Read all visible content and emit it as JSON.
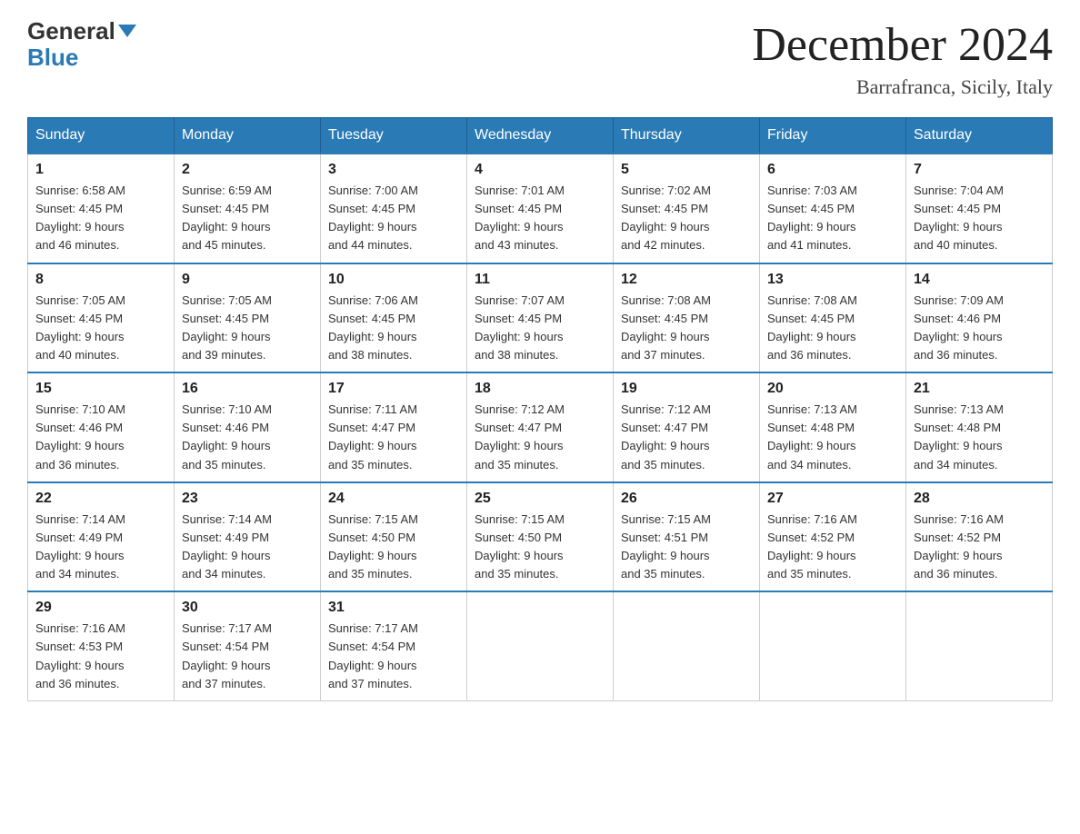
{
  "header": {
    "logo_line1": "General",
    "logo_line2": "Blue",
    "month_title": "December 2024",
    "location": "Barrafranca, Sicily, Italy"
  },
  "days_of_week": [
    "Sunday",
    "Monday",
    "Tuesday",
    "Wednesday",
    "Thursday",
    "Friday",
    "Saturday"
  ],
  "weeks": [
    [
      {
        "day": "1",
        "sunrise": "6:58 AM",
        "sunset": "4:45 PM",
        "daylight": "9 hours and 46 minutes."
      },
      {
        "day": "2",
        "sunrise": "6:59 AM",
        "sunset": "4:45 PM",
        "daylight": "9 hours and 45 minutes."
      },
      {
        "day": "3",
        "sunrise": "7:00 AM",
        "sunset": "4:45 PM",
        "daylight": "9 hours and 44 minutes."
      },
      {
        "day": "4",
        "sunrise": "7:01 AM",
        "sunset": "4:45 PM",
        "daylight": "9 hours and 43 minutes."
      },
      {
        "day": "5",
        "sunrise": "7:02 AM",
        "sunset": "4:45 PM",
        "daylight": "9 hours and 42 minutes."
      },
      {
        "day": "6",
        "sunrise": "7:03 AM",
        "sunset": "4:45 PM",
        "daylight": "9 hours and 41 minutes."
      },
      {
        "day": "7",
        "sunrise": "7:04 AM",
        "sunset": "4:45 PM",
        "daylight": "9 hours and 40 minutes."
      }
    ],
    [
      {
        "day": "8",
        "sunrise": "7:05 AM",
        "sunset": "4:45 PM",
        "daylight": "9 hours and 40 minutes."
      },
      {
        "day": "9",
        "sunrise": "7:05 AM",
        "sunset": "4:45 PM",
        "daylight": "9 hours and 39 minutes."
      },
      {
        "day": "10",
        "sunrise": "7:06 AM",
        "sunset": "4:45 PM",
        "daylight": "9 hours and 38 minutes."
      },
      {
        "day": "11",
        "sunrise": "7:07 AM",
        "sunset": "4:45 PM",
        "daylight": "9 hours and 38 minutes."
      },
      {
        "day": "12",
        "sunrise": "7:08 AM",
        "sunset": "4:45 PM",
        "daylight": "9 hours and 37 minutes."
      },
      {
        "day": "13",
        "sunrise": "7:08 AM",
        "sunset": "4:45 PM",
        "daylight": "9 hours and 36 minutes."
      },
      {
        "day": "14",
        "sunrise": "7:09 AM",
        "sunset": "4:46 PM",
        "daylight": "9 hours and 36 minutes."
      }
    ],
    [
      {
        "day": "15",
        "sunrise": "7:10 AM",
        "sunset": "4:46 PM",
        "daylight": "9 hours and 36 minutes."
      },
      {
        "day": "16",
        "sunrise": "7:10 AM",
        "sunset": "4:46 PM",
        "daylight": "9 hours and 35 minutes."
      },
      {
        "day": "17",
        "sunrise": "7:11 AM",
        "sunset": "4:47 PM",
        "daylight": "9 hours and 35 minutes."
      },
      {
        "day": "18",
        "sunrise": "7:12 AM",
        "sunset": "4:47 PM",
        "daylight": "9 hours and 35 minutes."
      },
      {
        "day": "19",
        "sunrise": "7:12 AM",
        "sunset": "4:47 PM",
        "daylight": "9 hours and 35 minutes."
      },
      {
        "day": "20",
        "sunrise": "7:13 AM",
        "sunset": "4:48 PM",
        "daylight": "9 hours and 34 minutes."
      },
      {
        "day": "21",
        "sunrise": "7:13 AM",
        "sunset": "4:48 PM",
        "daylight": "9 hours and 34 minutes."
      }
    ],
    [
      {
        "day": "22",
        "sunrise": "7:14 AM",
        "sunset": "4:49 PM",
        "daylight": "9 hours and 34 minutes."
      },
      {
        "day": "23",
        "sunrise": "7:14 AM",
        "sunset": "4:49 PM",
        "daylight": "9 hours and 34 minutes."
      },
      {
        "day": "24",
        "sunrise": "7:15 AM",
        "sunset": "4:50 PM",
        "daylight": "9 hours and 35 minutes."
      },
      {
        "day": "25",
        "sunrise": "7:15 AM",
        "sunset": "4:50 PM",
        "daylight": "9 hours and 35 minutes."
      },
      {
        "day": "26",
        "sunrise": "7:15 AM",
        "sunset": "4:51 PM",
        "daylight": "9 hours and 35 minutes."
      },
      {
        "day": "27",
        "sunrise": "7:16 AM",
        "sunset": "4:52 PM",
        "daylight": "9 hours and 35 minutes."
      },
      {
        "day": "28",
        "sunrise": "7:16 AM",
        "sunset": "4:52 PM",
        "daylight": "9 hours and 36 minutes."
      }
    ],
    [
      {
        "day": "29",
        "sunrise": "7:16 AM",
        "sunset": "4:53 PM",
        "daylight": "9 hours and 36 minutes."
      },
      {
        "day": "30",
        "sunrise": "7:17 AM",
        "sunset": "4:54 PM",
        "daylight": "9 hours and 37 minutes."
      },
      {
        "day": "31",
        "sunrise": "7:17 AM",
        "sunset": "4:54 PM",
        "daylight": "9 hours and 37 minutes."
      },
      null,
      null,
      null,
      null
    ]
  ],
  "labels": {
    "sunrise_prefix": "Sunrise: ",
    "sunset_prefix": "Sunset: ",
    "daylight_prefix": "Daylight: "
  }
}
